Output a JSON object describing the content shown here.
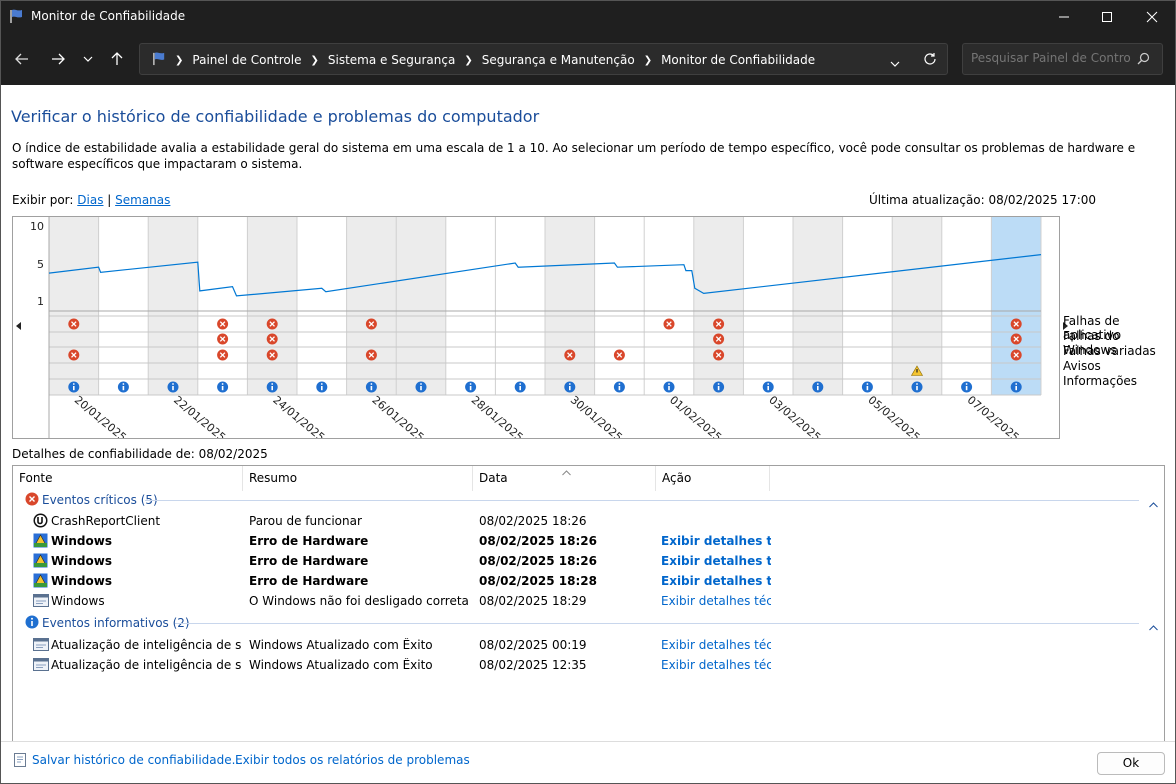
{
  "window": {
    "title": "Monitor de Confiabilidade"
  },
  "address": {
    "crumbs": [
      "Painel de Controle",
      "Sistema e Segurança",
      "Segurança e Manutenção",
      "Monitor de Confiabilidade"
    ]
  },
  "search": {
    "placeholder": "Pesquisar Painel de Controle"
  },
  "main": {
    "heading": "Verificar o histórico de confiabilidade e problemas do computador",
    "description": "O índice de estabilidade avalia a estabilidade geral do sistema em uma escala de 1 a 10. Ao selecionar um período de tempo específico, você pode consultar os problemas de hardware e software específicos que impactaram o sistema.",
    "view_by_label": "Exibir por:",
    "view_days": "Dias",
    "view_weeks": "Semanas",
    "last_updated": "Última atualização: 08/02/2025 17:00"
  },
  "chart_data": {
    "type": "line",
    "ylim": [
      1,
      10
    ],
    "yticks": [
      "10",
      "5",
      "1"
    ],
    "columns": 20,
    "selected_column": 19,
    "date_labels": [
      "20/01/2025",
      "22/01/2025",
      "24/01/2025",
      "26/01/2025",
      "28/01/2025",
      "30/01/2025",
      "01/02/2025",
      "03/02/2025",
      "05/02/2025",
      "07/02/2025"
    ],
    "stability_index": [
      [
        0,
        4.3
      ],
      [
        1,
        5.0
      ],
      [
        1.04,
        4.4
      ],
      [
        3,
        5.6
      ],
      [
        3.04,
        2.2
      ],
      [
        3.7,
        2.7
      ],
      [
        3.78,
        1.6
      ],
      [
        5.5,
        2.5
      ],
      [
        5.58,
        2.1
      ],
      [
        9.4,
        5.5
      ],
      [
        9.46,
        5.0
      ],
      [
        11.4,
        5.5
      ],
      [
        11.46,
        5.0
      ],
      [
        12.8,
        5.3
      ],
      [
        12.84,
        4.6
      ],
      [
        12.96,
        4.6
      ],
      [
        13.02,
        2.5
      ],
      [
        13.2,
        1.9
      ],
      [
        20,
        6.5
      ]
    ],
    "rows": [
      "Falhas de aplicativo",
      "Falhas do Windows",
      "Falhas variadas",
      "Avisos",
      "Informações"
    ],
    "events": {
      "app_failures": [
        0,
        3,
        4,
        6,
        12,
        13,
        19
      ],
      "windows_failures": [
        3,
        4,
        13,
        19
      ],
      "misc_failures": [
        0,
        3,
        4,
        6,
        10,
        11,
        13,
        19
      ],
      "warnings": [
        17
      ],
      "info": [
        0,
        1,
        2,
        3,
        4,
        5,
        6,
        7,
        8,
        9,
        10,
        11,
        12,
        13,
        14,
        15,
        16,
        17,
        18,
        19
      ]
    }
  },
  "details": {
    "label": "Detalhes de confiabilidade de: 08/02/2025",
    "columns": [
      "Fonte",
      "Resumo",
      "Data",
      "Ação"
    ],
    "group_critical": "Eventos críticos (5)",
    "group_info": "Eventos informativos (2)",
    "critical_rows": [
      {
        "source": "CrashReportClient",
        "summary": "Parou de funcionar",
        "date": "08/02/2025 18:26",
        "action": ""
      },
      {
        "source": "Windows",
        "summary": "Erro de Hardware",
        "date": "08/02/2025 18:26",
        "action": "Exibir detalhes t..."
      },
      {
        "source": "Windows",
        "summary": "Erro de Hardware",
        "date": "08/02/2025 18:26",
        "action": "Exibir detalhes t..."
      },
      {
        "source": "Windows",
        "summary": "Erro de Hardware",
        "date": "08/02/2025 18:28",
        "action": "Exibir detalhes t..."
      },
      {
        "source": "Windows",
        "summary": "O Windows não foi desligado corretam...",
        "date": "08/02/2025 18:29",
        "action": "Exibir detalhes téc..."
      }
    ],
    "info_rows": [
      {
        "source": "Atualização de inteligência de seg...",
        "summary": "Windows Atualizado com Êxito",
        "date": "08/02/2025 00:19",
        "action": "Exibir detalhes téc..."
      },
      {
        "source": "Atualização de inteligência de seg...",
        "summary": "Windows Atualizado com Êxito",
        "date": "08/02/2025 12:35",
        "action": "Exibir detalhes téc..."
      }
    ]
  },
  "footer": {
    "save_link": "Salvar histórico de confiabilidade...",
    "all_reports_link": "Exibir todos os relatórios de problemas",
    "ok_label": "Ok"
  },
  "colors": {
    "accent": "#0078d4",
    "link": "#0066cc",
    "error": "#d9472b",
    "selected_column": "#bcdcf6"
  }
}
